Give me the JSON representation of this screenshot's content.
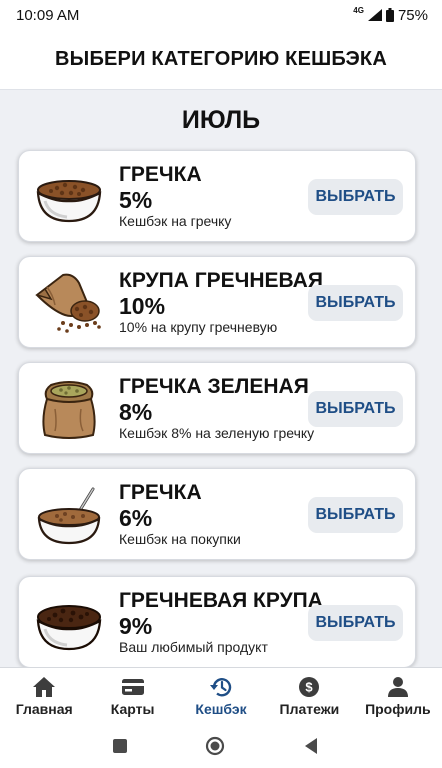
{
  "status_bar": {
    "time": "10:09 AM",
    "network": "4G",
    "battery": "75%"
  },
  "header": {
    "title": "ВЫБЕРИ КАТЕГОРИЮ КЕШБЭКА"
  },
  "month": "ИЮЛЬ",
  "button_label": "ВЫБРАТЬ",
  "categories": [
    {
      "title": "ГРЕЧКА",
      "percent": "5%",
      "description": "Кешбэк на гречку",
      "icon": "buckwheat-bowl-icon"
    },
    {
      "title": "КРУПА ГРЕЧНЕВАЯ",
      "percent": "10%",
      "description": "10% на крупу гречневую",
      "icon": "spilled-sack-icon"
    },
    {
      "title": "ГРЕЧКА ЗЕЛЕНАЯ",
      "percent": "8%",
      "description": "Кешбэк 8% на зеленую гречку",
      "icon": "green-buckwheat-sack-icon"
    },
    {
      "title": "ГРЕЧКА",
      "percent": "6%",
      "description": "Кешбэк на покупки",
      "icon": "porridge-bowl-spoon-icon"
    },
    {
      "title": "ГРЕЧНЕВАЯ КРУПА",
      "percent": "9%",
      "description": "Ваш любимый продукт",
      "icon": "dark-buckwheat-bowl-icon"
    }
  ],
  "bottom_nav": [
    {
      "label": "Главная",
      "icon": "home-icon"
    },
    {
      "label": "Карты",
      "icon": "card-icon"
    },
    {
      "label": "Кешбэк",
      "icon": "history-icon",
      "active": true
    },
    {
      "label": "Платежи",
      "icon": "dollar-coin-icon"
    },
    {
      "label": "Профиль",
      "icon": "user-icon"
    }
  ],
  "colors": {
    "accent": "#1f4e86",
    "button_bg": "#e8ebef",
    "page_bg": "#eef0f4"
  }
}
